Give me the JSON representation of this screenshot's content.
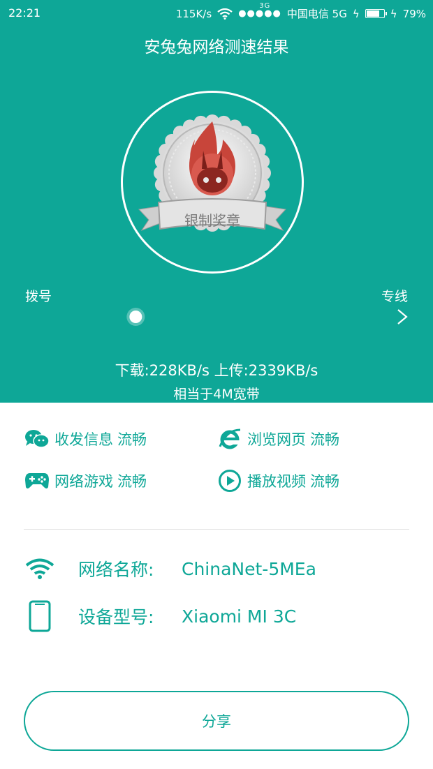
{
  "status_bar": {
    "time": "22:21",
    "net_speed": "115K/s",
    "signal_badge": "3G",
    "carrier": "中国电信 5G",
    "battery": "79%",
    "battery_level": 0.79
  },
  "header": {
    "title": "安兔兔网络测速结果"
  },
  "badge": {
    "label": "银制奖章"
  },
  "scale": {
    "left_label": "拨号",
    "right_label": "专线",
    "position": 0.29
  },
  "result": {
    "speed": "下载:228KB/s 上传:2339KB/s",
    "equivalent": "相当于4M宽带"
  },
  "features": [
    {
      "icon": "wechat-icon",
      "label": "收发信息",
      "status": "流畅"
    },
    {
      "icon": "ie-browser-icon",
      "label": "浏览网页",
      "status": "流畅"
    },
    {
      "icon": "gamepad-icon",
      "label": "网络游戏",
      "status": "流畅"
    },
    {
      "icon": "play-icon",
      "label": "播放视频",
      "status": "流畅"
    }
  ],
  "info": {
    "network_label": "网络名称:",
    "network_value": "ChinaNet-5MEa",
    "device_label": "设备型号:",
    "device_value": "Xiaomi MI 3C"
  },
  "share_label": "分享",
  "colors": {
    "accent": "#0ea797",
    "badge_red": "#c8453a"
  }
}
